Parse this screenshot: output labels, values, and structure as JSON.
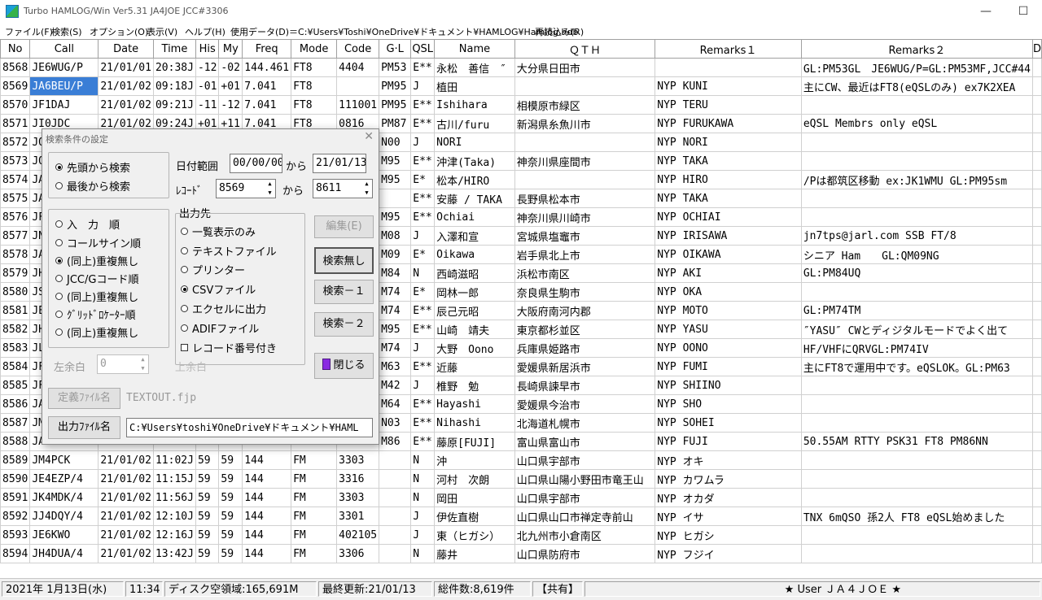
{
  "window": {
    "title": "Turbo HAMLOG/Win Ver5.31 JA4JOE JCC#3306",
    "minimize": "—",
    "maximize": "☐"
  },
  "menu": [
    "ファイル(F)",
    "検索(S)",
    "オプション(O)",
    "表示(V)",
    "ヘルプ(H)",
    "使用データ(D)＝C:¥Users¥Toshi¥OneDrive¥ドキュメント¥HAMLOG¥Hamlog.hdb",
    "再読込み(R)"
  ],
  "table": {
    "columns": [
      "No",
      "Call",
      "Date",
      "Time",
      "His",
      "My",
      "Freq",
      "Mode",
      "Code",
      "G·L",
      "QSL",
      "Name",
      "ＱＴＨ",
      "Remarks１",
      "Remarks２",
      "D"
    ],
    "selected_row": 1,
    "rows": [
      [
        "8568",
        "JE6WUG/P",
        "21/01/01",
        "20:38J",
        "-12",
        "-02",
        "144.461",
        "FT8",
        "4404",
        "PM53",
        "E**",
        "永松　善信　″",
        "大分県日田市",
        "",
        "GL:PM53GL　JE6WUG/P=GL:PM53MF,JCC#44"
      ],
      [
        "8569",
        "JA6BEU/P",
        "21/01/02",
        "09:18J",
        "-01",
        "+01",
        "7.041",
        "FT8",
        "",
        "PM95",
        "J",
        "植田",
        "",
        "NYP KUNI",
        "主にCW、最近はFT8(eQSLのみ) ex7K2XEA"
      ],
      [
        "8570",
        "JF1DAJ",
        "21/01/02",
        "09:21J",
        "-11",
        "-12",
        "7.041",
        "FT8",
        "111001",
        "PM95",
        "E**",
        "Ishihara",
        "相模原市緑区",
        "NYP TERU",
        ""
      ],
      [
        "8571",
        "JI0JDC",
        "21/01/02",
        "09:24J",
        "+01",
        "+11",
        "7.041",
        "FT8",
        "0816",
        "PM87",
        "E**",
        "古川/furu",
        "新潟県糸魚川市",
        "NYP FURUKAWA",
        "eQSL Membrs only eQSL"
      ],
      [
        "8572",
        "JO",
        "",
        "",
        "",
        "",
        "",
        "",
        "",
        "N00",
        "J",
        "NORI",
        "",
        "NYP NORI",
        ""
      ],
      [
        "8573",
        "JO",
        "",
        "",
        "",
        "",
        "",
        "",
        "",
        "M95",
        "E**",
        "沖津(Taka)",
        "神奈川県座間市",
        "NYP TAKA",
        ""
      ],
      [
        "8574",
        "JA",
        "",
        "",
        "",
        "",
        "",
        "",
        "",
        "M95",
        "E*",
        "松本/HIRO",
        "",
        "NYP HIRO",
        "/Pは都筑区移動 ex:JK1WMU GL:PM95sm"
      ],
      [
        "8575",
        "JA",
        "",
        "",
        "",
        "",
        "",
        "",
        "",
        "",
        "E**",
        "安藤 / TAKA",
        "長野県松本市",
        "NYP TAKA",
        ""
      ],
      [
        "8576",
        "JF",
        "",
        "",
        "",
        "",
        "",
        "",
        "",
        "M95",
        "E**",
        "Ochiai",
        "神奈川県川崎市",
        "NYP OCHIAI",
        ""
      ],
      [
        "8577",
        "JN",
        "",
        "",
        "",
        "",
        "",
        "",
        "",
        "M08",
        "J",
        "入澤和宣",
        "宮城県塩竈市",
        "NYP IRISAWA",
        "jn7tps@jarl.com SSB FT/8"
      ],
      [
        "8578",
        "JA",
        "",
        "",
        "",
        "",
        "",
        "",
        "",
        "M09",
        "E*",
        "Oikawa",
        "岩手県北上市",
        "NYP OIKAWA",
        "シニア Ham　　GL:QM09NG"
      ],
      [
        "8579",
        "JH",
        "",
        "",
        "",
        "",
        "",
        "",
        "",
        "M84",
        "N",
        "西崎滋昭",
        "浜松市南区",
        "NYP AKI",
        "GL:PM84UQ"
      ],
      [
        "8580",
        "JS",
        "",
        "",
        "",
        "",
        "",
        "",
        "",
        "M74",
        "E*",
        "岡林一郎",
        "奈良県生駒市",
        "NYP OKA",
        ""
      ],
      [
        "8581",
        "JE",
        "",
        "",
        "",
        "",
        "",
        "",
        "",
        "M74",
        "E**",
        "辰己元昭",
        "大阪府南河内郡",
        "NYP MOTO",
        "GL:PM74TM"
      ],
      [
        "8582",
        "JH",
        "",
        "",
        "",
        "",
        "",
        "",
        "",
        "M95",
        "E**",
        "山崎　靖夫",
        "東京都杉並区",
        "NYP YASU",
        "″YASU″ CWとディジタルモードでよく出て"
      ],
      [
        "8583",
        "JL",
        "",
        "",
        "",
        "",
        "",
        "",
        "",
        "M74",
        "J",
        "大野　Oono",
        "兵庫県姫路市",
        "NYP OONO",
        "HF/VHFにQRVGL:PM74IV"
      ],
      [
        "8584",
        "JF",
        "",
        "",
        "",
        "",
        "",
        "",
        "",
        "M63",
        "E**",
        "近藤",
        "愛媛県新居浜市",
        "NYP FUMI",
        "主にFT8で運用中です。eQSLOK。GL:PM63"
      ],
      [
        "8585",
        "JF",
        "",
        "",
        "",
        "",
        "",
        "",
        "",
        "M42",
        "J",
        "椎野　勉",
        "長崎県諫早市",
        "NYP SHIINO",
        ""
      ],
      [
        "8586",
        "JA",
        "",
        "",
        "",
        "",
        "",
        "",
        "",
        "M64",
        "E**",
        "Hayashi",
        "愛媛県今治市",
        "NYP SHO",
        ""
      ],
      [
        "8587",
        "JM",
        "",
        "",
        "",
        "",
        "",
        "",
        "",
        "N03",
        "E**",
        "Nihashi",
        "北海道札幌市",
        "NYP SOHEI",
        ""
      ],
      [
        "8588",
        "JA",
        "",
        "",
        "",
        "",
        "",
        "",
        "",
        "M86",
        "E**",
        "藤原[FUJI]",
        "富山県富山市",
        "NYP FUJI",
        "50.55AM RTTY PSK31 FT8 PM86NN"
      ],
      [
        "8589",
        "JM4PCK",
        "21/01/02",
        "11:02J",
        "59",
        "59",
        "144",
        "FM",
        "3303",
        "",
        "N",
        "沖",
        "山口県宇部市",
        "NYP オキ",
        ""
      ],
      [
        "8590",
        "JE4EZP/4",
        "21/01/02",
        "11:15J",
        "59",
        "59",
        "144",
        "FM",
        "3316",
        "",
        "N",
        "河村　次朗",
        "山口県山陽小野田市竜王山",
        "NYP カワムラ",
        ""
      ],
      [
        "8591",
        "JK4MDK/4",
        "21/01/02",
        "11:56J",
        "59",
        "59",
        "144",
        "FM",
        "3303",
        "",
        "N",
        "岡田",
        "山口県宇部市",
        "NYP オカダ",
        ""
      ],
      [
        "8592",
        "JJ4DQY/4",
        "21/01/02",
        "12:10J",
        "59",
        "59",
        "144",
        "FM",
        "3301",
        "",
        "J",
        "伊佐直樹",
        "山口県山口市禅定寺前山",
        "NYP イサ",
        "TNX 6mQSO 孫2人 FT8 eQSL始めました"
      ],
      [
        "8593",
        "JE6KWO",
        "21/01/02",
        "12:16J",
        "59",
        "59",
        "144",
        "FM",
        "402105",
        "",
        "J",
        "東（ヒガシ）",
        "北九州市小倉南区",
        "NYP ヒガシ",
        ""
      ],
      [
        "8594",
        "JH4DUA/4",
        "21/01/02",
        "13:42J",
        "59",
        "59",
        "144",
        "FM",
        "3306",
        "",
        "N",
        "藤井",
        "山口県防府市",
        "NYP フジイ",
        ""
      ]
    ]
  },
  "dialog": {
    "title": "検索条件の設定",
    "search_direction": [
      "先頭から検索",
      "最後から検索"
    ],
    "date_range_label": "日付範囲",
    "date_from": "00/00/00",
    "date_to": "21/01/13",
    "from_label": "から",
    "record_label": "ﾚｺｰﾄﾞ",
    "record_from": "8569",
    "record_to": "8611",
    "sort_options": [
      "入　力　順",
      "コールサイン順",
      "(同上)重複無し",
      "JCC/Gコード順",
      "(同上)重複無し",
      "ｸﾞﾘｯﾄﾞﾛｹｰﾀｰ順",
      "(同上)重複無し"
    ],
    "output_group_label": "出力先",
    "output_options": [
      "一覧表示のみ",
      "テキストファイル",
      "プリンター",
      "CSVファイル",
      "エクセルに出力",
      "ADIFファイル"
    ],
    "record_number_check": "レコード番号付き",
    "left_margin_label": "左余白",
    "left_margin_value": "0",
    "hidden_label": "上余白",
    "def_file_button": "定義ﾌｧｲﾙ名",
    "def_file_value": "TEXTOUT.fjp",
    "out_file_button": "出力ﾌｧｲﾙ名",
    "out_file_value": "C:¥Users¥toshi¥OneDrive¥ドキュメント¥HAML",
    "buttons": {
      "edit": "編集(E)",
      "no_search": "検索無し",
      "search1": "検索－１",
      "search2": "検索－２",
      "close": "閉じる"
    }
  },
  "status": {
    "date": "2021年 1月13日(水)",
    "time": "11:34",
    "disk": "ディスク空領域:165,691M",
    "updated": "最終更新:21/01/13",
    "total": "総件数:8,619件",
    "shared": "【共有】",
    "user": "★ User ＪＡ４ＪＯＥ ★"
  }
}
